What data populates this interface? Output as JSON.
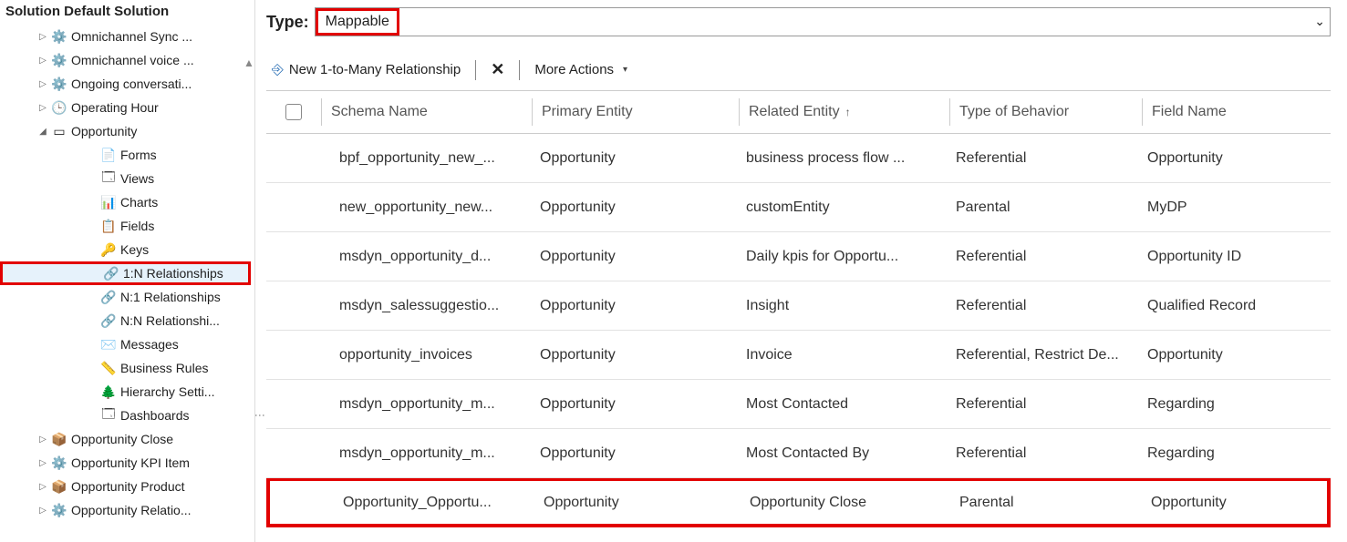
{
  "sidebar_title": "Solution Default Solution",
  "type_label": "Type:",
  "type_value": "Mappable",
  "toolbar": {
    "new_label": "New 1-to-Many Relationship",
    "delete_label": "Delete",
    "more_label": "More Actions"
  },
  "headers": {
    "schema": "Schema Name",
    "primary": "Primary Entity",
    "related": "Related Entity",
    "behavior": "Type of Behavior",
    "field": "Field Name"
  },
  "tree": [
    {
      "depth": 1,
      "expander": "▷",
      "icon": "⚙️",
      "label": "Omnichannel Sync ..."
    },
    {
      "depth": 1,
      "expander": "▷",
      "icon": "⚙️",
      "label": "Omnichannel voice ..."
    },
    {
      "depth": 1,
      "expander": "▷",
      "icon": "⚙️",
      "label": "Ongoing conversati..."
    },
    {
      "depth": 1,
      "expander": "▷",
      "icon": "🕒",
      "label": "Operating Hour"
    },
    {
      "depth": 1,
      "expander": "◢",
      "icon": "▭",
      "label": "Opportunity"
    },
    {
      "depth": 2,
      "expander": "",
      "icon": "📄",
      "label": "Forms"
    },
    {
      "depth": 2,
      "expander": "",
      "icon": "🗔",
      "label": "Views"
    },
    {
      "depth": 2,
      "expander": "",
      "icon": "📊",
      "label": "Charts"
    },
    {
      "depth": 2,
      "expander": "",
      "icon": "📋",
      "label": "Fields"
    },
    {
      "depth": 2,
      "expander": "",
      "icon": "🔑",
      "label": "Keys"
    },
    {
      "depth": 2,
      "expander": "",
      "icon": "🔗",
      "label": "1:N Relationships",
      "selected": true,
      "highlight": true
    },
    {
      "depth": 2,
      "expander": "",
      "icon": "🔗",
      "label": "N:1 Relationships"
    },
    {
      "depth": 2,
      "expander": "",
      "icon": "🔗",
      "label": "N:N Relationshi..."
    },
    {
      "depth": 2,
      "expander": "",
      "icon": "✉️",
      "label": "Messages"
    },
    {
      "depth": 2,
      "expander": "",
      "icon": "📏",
      "label": "Business Rules"
    },
    {
      "depth": 2,
      "expander": "",
      "icon": "🌲",
      "label": "Hierarchy Setti..."
    },
    {
      "depth": 2,
      "expander": "",
      "icon": "🗔",
      "label": "Dashboards"
    },
    {
      "depth": 1,
      "expander": "▷",
      "icon": "📦",
      "label": "Opportunity Close"
    },
    {
      "depth": 1,
      "expander": "▷",
      "icon": "⚙️",
      "label": "Opportunity KPI Item"
    },
    {
      "depth": 1,
      "expander": "▷",
      "icon": "📦",
      "label": "Opportunity Product"
    },
    {
      "depth": 1,
      "expander": "▷",
      "icon": "⚙️",
      "label": "Opportunity Relatio..."
    }
  ],
  "rows": [
    {
      "schema": "bpf_opportunity_new_...",
      "primary": "Opportunity",
      "related": "business process flow ...",
      "behavior": "Referential",
      "field": "Opportunity"
    },
    {
      "schema": "new_opportunity_new...",
      "primary": "Opportunity",
      "related": "customEntity",
      "behavior": "Parental",
      "field": "MyDP"
    },
    {
      "schema": "msdyn_opportunity_d...",
      "primary": "Opportunity",
      "related": "Daily kpis for Opportu...",
      "behavior": "Referential",
      "field": "Opportunity ID"
    },
    {
      "schema": "msdyn_salessuggestio...",
      "primary": "Opportunity",
      "related": "Insight",
      "behavior": "Referential",
      "field": "Qualified Record"
    },
    {
      "schema": "opportunity_invoices",
      "primary": "Opportunity",
      "related": "Invoice",
      "behavior": "Referential, Restrict De...",
      "field": "Opportunity"
    },
    {
      "schema": "msdyn_opportunity_m...",
      "primary": "Opportunity",
      "related": "Most Contacted",
      "behavior": "Referential",
      "field": "Regarding"
    },
    {
      "schema": "msdyn_opportunity_m...",
      "primary": "Opportunity",
      "related": "Most Contacted By",
      "behavior": "Referential",
      "field": "Regarding"
    },
    {
      "schema": "Opportunity_Opportu...",
      "primary": "Opportunity",
      "related": "Opportunity Close",
      "behavior": "Parental",
      "field": "Opportunity",
      "highlight": true
    }
  ]
}
